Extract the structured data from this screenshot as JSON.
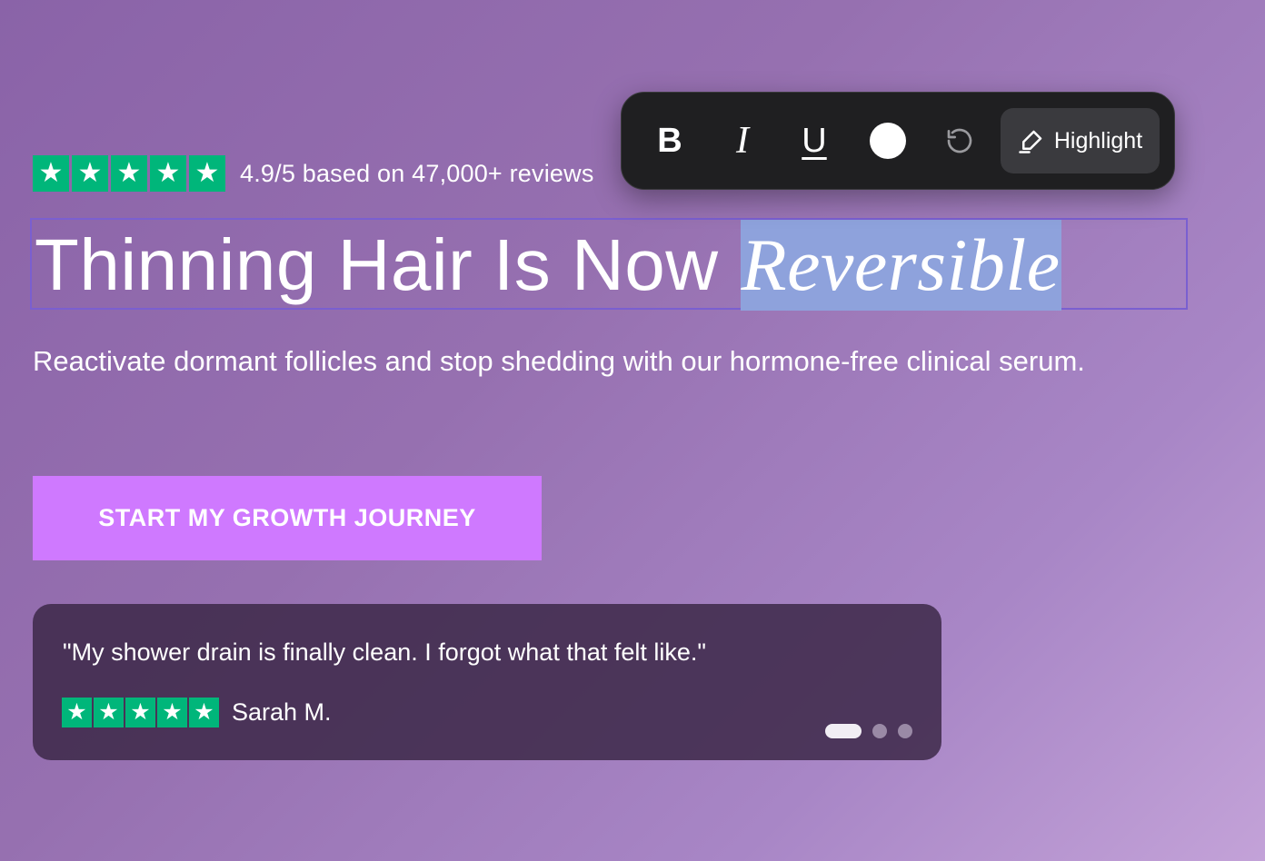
{
  "rating": {
    "stars": 5,
    "text": "4.9/5 based on 47,000+ reviews"
  },
  "headline": {
    "main": "Thinning Hair Is Now",
    "emphasis": "Reversible"
  },
  "subtitle": "Reactivate dormant follicles and stop shedding with our hormone-free clinical serum.",
  "cta": {
    "label": "START MY GROWTH JOURNEY"
  },
  "review": {
    "quote": "\"My shower drain is finally clean. I forgot what that felt like.\"",
    "stars": 5,
    "author": "Sarah M.",
    "carousel_total": 3,
    "carousel_active": 1
  },
  "toolbar": {
    "bold_label": "B",
    "italic_label": "I",
    "underline_label": "U",
    "color": "#ffffff",
    "highlight_label": "Highlight"
  },
  "colors": {
    "star_green": "#00b67a",
    "cta": "#cf79ff",
    "selection": "#8ea2dc",
    "selection_outline": "#7a5fd0"
  }
}
